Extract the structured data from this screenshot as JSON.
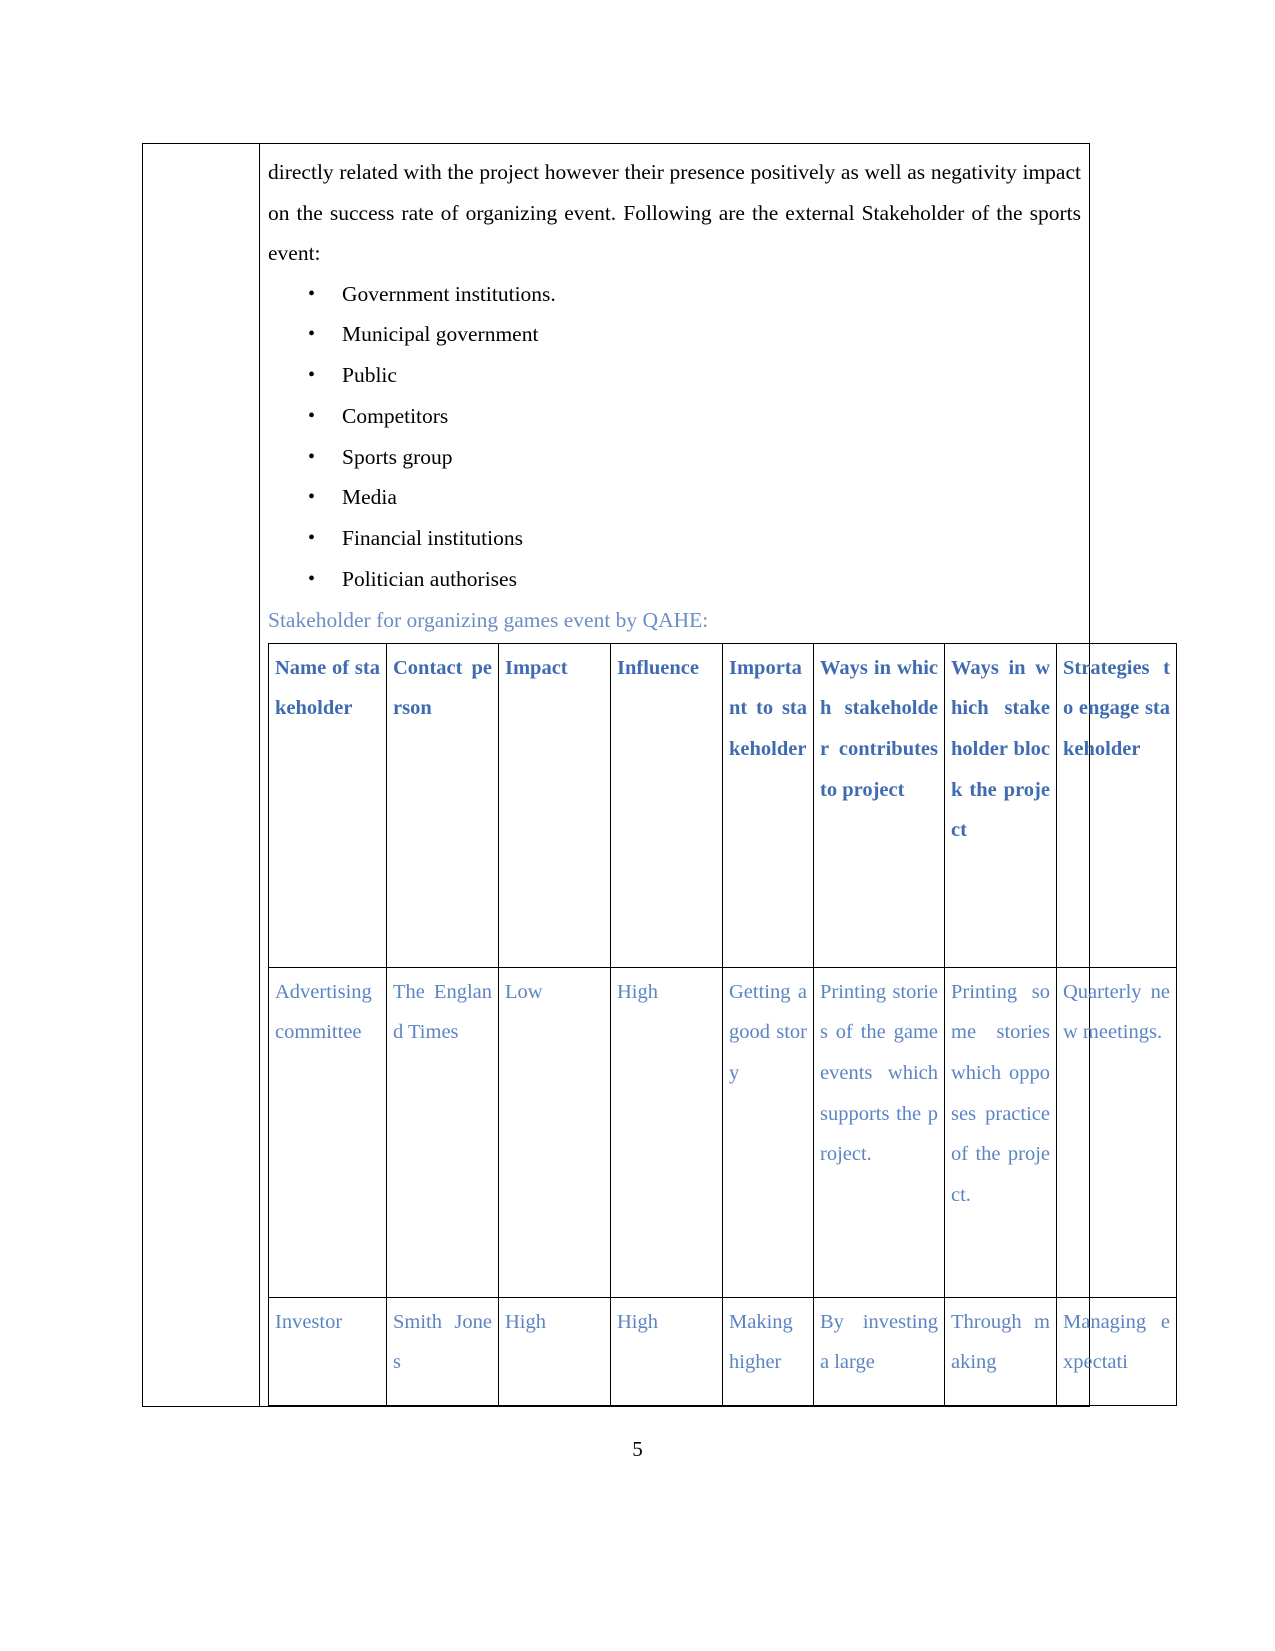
{
  "document": {
    "page_number": "5",
    "intro_paragraph": "directly related with the project however their presence positively as well as negativity impact on the success rate of organizing event. Following are the external Stakeholder of the sports event:",
    "bullets": [
      "Government institutions.",
      "Municipal government",
      "Public",
      "Competitors",
      "Sports group",
      "Media",
      "Financial institutions",
      "Politician authorises"
    ],
    "caption": "Stakeholder for organizing games event by QAHE:"
  },
  "colors": {
    "caption_blue": "#6b8ec4",
    "header_blue": "#3f6cb0",
    "cell_blue": "#5b84c2",
    "border_black": "#000000"
  },
  "table": {
    "headers": [
      "Name of stakeholder",
      "Contact person",
      "Impact",
      "Influence",
      "Important to stakeholder",
      "Ways in which stakeholder contributes to project",
      "Ways in which stakeholder block the project",
      "Strategies to engage stakeholder"
    ],
    "rows": [
      [
        "Advertising committee",
        "The England Times",
        "Low",
        "High",
        "Getting a good story",
        "Printing stories of the game events which supports the project.",
        "Printing some stories which opposes practice of the project.",
        "Quarterly new meetings."
      ],
      [
        "Investor",
        "Smith Jones",
        "High",
        "High",
        "Making higher",
        "By investing a large",
        "Through making",
        "Managing expectati"
      ]
    ]
  }
}
